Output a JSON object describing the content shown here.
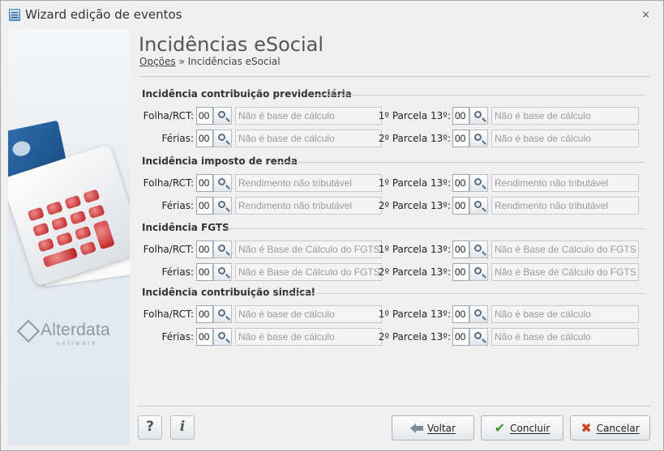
{
  "window": {
    "title": "Wizard edição de eventos"
  },
  "header": {
    "title": "Incidências eSocial",
    "breadcrumb": {
      "link": "Opções",
      "separator": " » ",
      "current": "Incidências eSocial"
    }
  },
  "sidebar": {
    "logo_text": "Alterdata",
    "logo_sub": "software"
  },
  "sections": [
    {
      "title": "Incidência contribuição previdenciária",
      "rows": [
        {
          "left_label": "Folha/RCT:",
          "left_code": "00",
          "left_desc": "Não é base de cálculo",
          "right_label": "1º Parcela 13º:",
          "right_code": "00",
          "right_desc": "Não é base de cálculo"
        },
        {
          "left_label": "Férias:",
          "left_code": "00",
          "left_desc": "Não é base de cálculo",
          "right_label": "2º Parcela 13º:",
          "right_code": "00",
          "right_desc": "Não é base de cálculo"
        }
      ]
    },
    {
      "title": "Incidência imposto de renda",
      "rows": [
        {
          "left_label": "Folha/RCT:",
          "left_code": "00",
          "left_desc": "Rendimento não tributável",
          "right_label": "1º Parcela 13º:",
          "right_code": "00",
          "right_desc": "Rendimento não tributável"
        },
        {
          "left_label": "Férias:",
          "left_code": "00",
          "left_desc": "Rendimento não tributável",
          "right_label": "2º Parcela 13º:",
          "right_code": "00",
          "right_desc": "Rendimento não tributável"
        }
      ]
    },
    {
      "title": "Incidência FGTS",
      "rows": [
        {
          "left_label": "Folha/RCT:",
          "left_code": "00",
          "left_desc": "Não é Base de Cálculo do FGTS",
          "right_label": "1º Parcela 13º:",
          "right_code": "00",
          "right_desc": "Não é Base de Cálculo do FGTS"
        },
        {
          "left_label": "Férias:",
          "left_code": "00",
          "left_desc": "Não é Base de Cálculo do FGTS",
          "right_label": "2º Parcela 13º:",
          "right_code": "00",
          "right_desc": "Não é Base de Cálculo do FGTS"
        }
      ]
    },
    {
      "title": "Incidência contribuição sindical",
      "rows": [
        {
          "left_label": "Folha/RCT:",
          "left_code": "00",
          "left_desc": "Não é base de cálculo",
          "right_label": "1º Parcela 13º:",
          "right_code": "00",
          "right_desc": "Não é base de cálculo"
        },
        {
          "left_label": "Férias:",
          "left_code": "00",
          "left_desc": "Não é base de cálculo",
          "right_label": "2º Parcela 13º:",
          "right_code": "00",
          "right_desc": "Não é base de cálculo"
        }
      ]
    }
  ],
  "footer": {
    "help_icon": "?",
    "info_icon": "i",
    "back_label": "Voltar",
    "finish_label": "Concluir",
    "cancel_label": "Cancelar",
    "check_icon": "✔",
    "x_icon": "✖"
  },
  "icons": {
    "close": "⨯"
  }
}
